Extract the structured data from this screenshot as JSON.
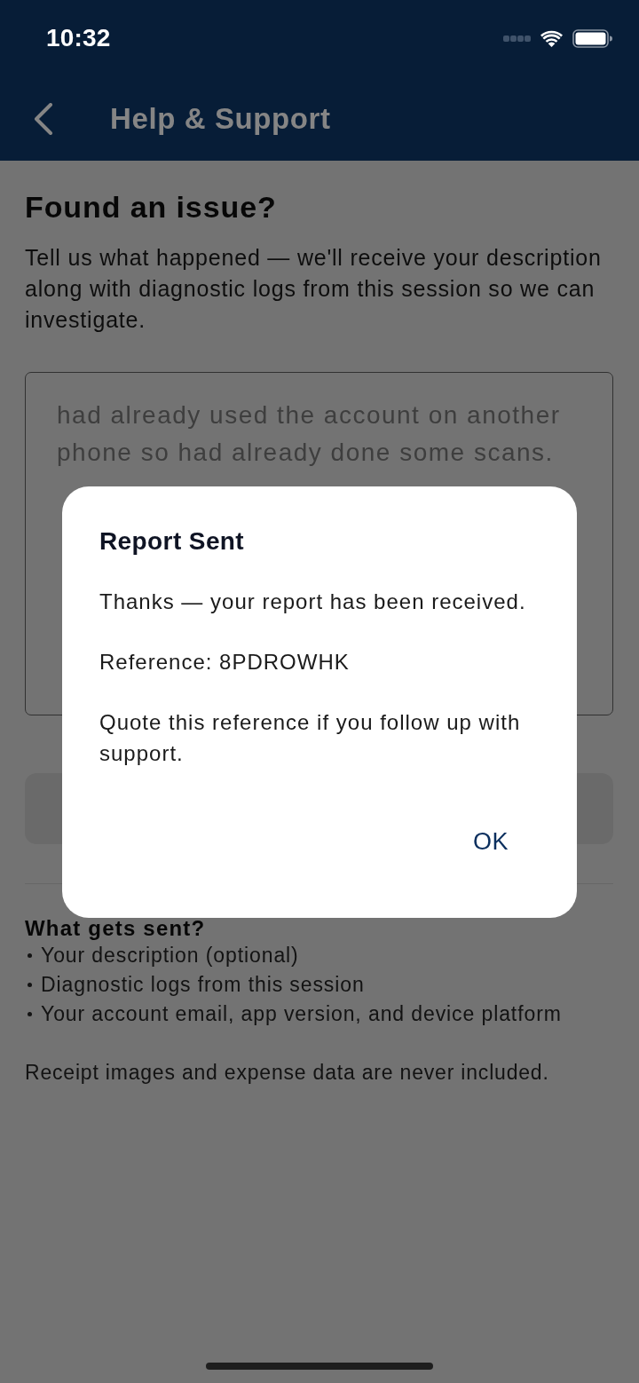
{
  "status_bar": {
    "time": "10:32"
  },
  "nav_bar": {
    "title": "Help & Support"
  },
  "page": {
    "heading": "Found an issue?",
    "intro": "Tell us what happened — we'll receive your description along with diagnostic logs from this session so we can investigate.",
    "description": {
      "value": "had already used the account on another phone so had already done some scans."
    },
    "info": {
      "heading": "What gets sent?",
      "items": [
        "Your description (optional)",
        "Diagnostic logs from this session",
        "Your account email, app version, and device platform"
      ],
      "note": "Receipt images and expense data are never included."
    }
  },
  "dialog": {
    "title": "Report Sent",
    "paragraphs": [
      "Thanks — your report has been received.",
      "Reference: 8PDROWHK",
      "Quote this reference if you follow up with support."
    ],
    "button": "OK"
  }
}
